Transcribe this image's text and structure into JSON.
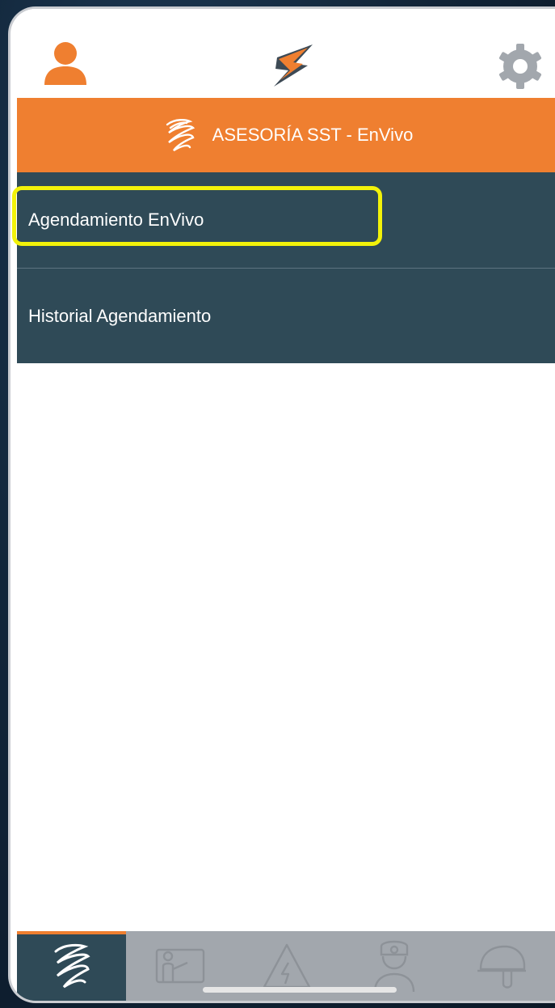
{
  "colors": {
    "accent_orange": "#ef7f30",
    "menu_bg": "#2f4a57",
    "tabbar_bg": "#a2a7ad",
    "highlight": "#f2f20a",
    "gear_gray": "#a2a7ad"
  },
  "topbar": {
    "left_icon": "user-icon",
    "center_icon": "app-logo-icon",
    "right_icon": "gear-icon"
  },
  "header": {
    "icon": "scribble-icon",
    "title": "ASESORÍA SST - EnVivo"
  },
  "menu": {
    "items": [
      {
        "label": "Agendamiento EnVivo",
        "highlighted": true
      },
      {
        "label": "Historial Agendamiento",
        "highlighted": false
      }
    ]
  },
  "tabbar": {
    "tabs": [
      {
        "icon": "scribble-icon",
        "active": true
      },
      {
        "icon": "presentation-icon",
        "active": false
      },
      {
        "icon": "electric-hazard-icon",
        "active": false
      },
      {
        "icon": "doctor-icon",
        "active": false
      },
      {
        "icon": "safety-helmet-icon",
        "active": false
      }
    ]
  }
}
